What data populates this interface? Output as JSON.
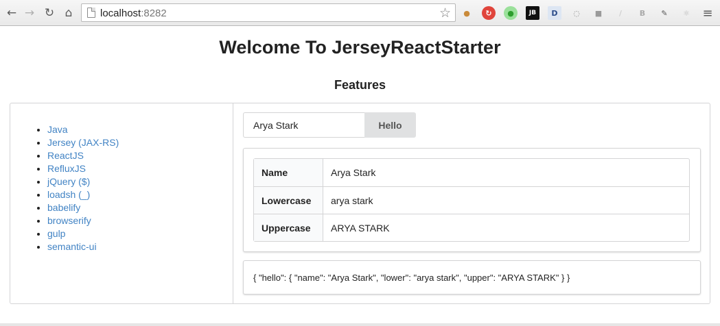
{
  "browser": {
    "url_host": "localhost",
    "url_port": ":8282",
    "icons": [
      "back-icon",
      "forward-icon",
      "reload-icon",
      "home-icon",
      "bookmark-star-icon",
      "menu-icon"
    ],
    "extensions": [
      {
        "name": "cookie-extension-icon",
        "glyph": "●",
        "color": "#c98a3a",
        "bg": "transparent"
      },
      {
        "name": "red-extension-icon",
        "glyph": "↻",
        "color": "#ffffff",
        "bg": "#e0453c"
      },
      {
        "name": "green-extension-icon",
        "glyph": "●",
        "color": "#2e9e2e",
        "bg": "#9be09b"
      },
      {
        "name": "jb-extension-icon",
        "glyph": "JB",
        "color": "#ffffff",
        "bg": "#111111"
      },
      {
        "name": "of-extension-icon",
        "glyph": "D",
        "color": "#2b4c8a",
        "bg": "#dde6f3"
      },
      {
        "name": "ring-extension-icon",
        "glyph": "◌",
        "color": "#888888",
        "bg": "transparent"
      },
      {
        "name": "grey-extension-icon",
        "glyph": "■",
        "color": "#9a9a9a",
        "bg": "transparent"
      },
      {
        "name": "feather-extension-icon",
        "glyph": "/",
        "color": "#cfcfcf",
        "bg": "transparent"
      },
      {
        "name": "b-extension-icon",
        "glyph": "B",
        "color": "#aaaaaa",
        "bg": "transparent"
      },
      {
        "name": "pencil-extension-icon",
        "glyph": "✎",
        "color": "#555555",
        "bg": "transparent"
      },
      {
        "name": "react-extension-icon",
        "glyph": "⚛",
        "color": "#bbbbbb",
        "bg": "transparent"
      }
    ]
  },
  "page": {
    "title": "Welcome To JerseyReactStarter",
    "section_title": "Features"
  },
  "features": [
    "Java",
    "Jersey (JAX-RS)",
    "ReactJS",
    "RefluxJS",
    "jQuery ($)",
    "loadsh (_)",
    "babelify",
    "browserify",
    "gulp",
    "semantic-ui"
  ],
  "form": {
    "name_value": "Arya Stark",
    "button_label": "Hello"
  },
  "result_table": {
    "rows": [
      {
        "label": "Name",
        "value": "Arya Stark"
      },
      {
        "label": "Lowercase",
        "value": "arya stark"
      },
      {
        "label": "Uppercase",
        "value": "ARYA STARK"
      }
    ]
  },
  "json_output": "{ \"hello\": { \"name\": \"Arya Stark\", \"lower\": \"arya stark\", \"upper\": \"ARYA STARK\" } }",
  "colors": {
    "link": "#4183c4",
    "button_bg": "#e0e1e2",
    "border": "#d4d4d5"
  }
}
